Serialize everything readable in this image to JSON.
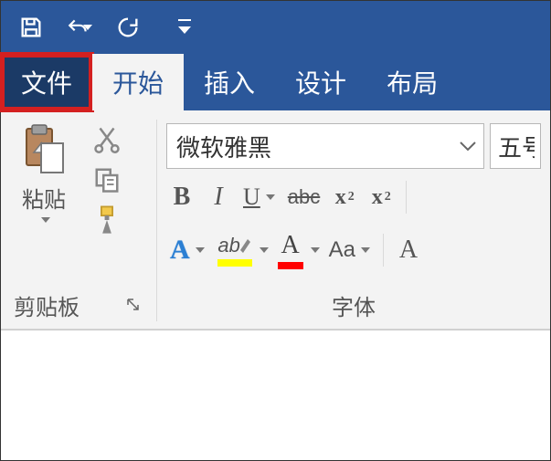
{
  "qat": {
    "save": "save-icon",
    "undo": "undo-icon",
    "redo": "redo-icon",
    "customize": "customize-icon"
  },
  "tabs": {
    "file": "文件",
    "home": "开始",
    "insert": "插入",
    "design": "设计",
    "layout": "布局"
  },
  "clipboard": {
    "paste": "粘贴",
    "group_label": "剪贴板"
  },
  "font": {
    "font_name": "微软雅黑",
    "font_size": "五号",
    "bold": "B",
    "italic": "I",
    "underline": "U",
    "strike": "abc",
    "subscript_label": "x",
    "subscript_sub": "2",
    "superscript_label": "x",
    "superscript_sup": "2",
    "text_effects": "A",
    "highlight": "ab",
    "font_color": "A",
    "change_case": "Aa",
    "clear_format": "A",
    "group_label": "字体"
  }
}
